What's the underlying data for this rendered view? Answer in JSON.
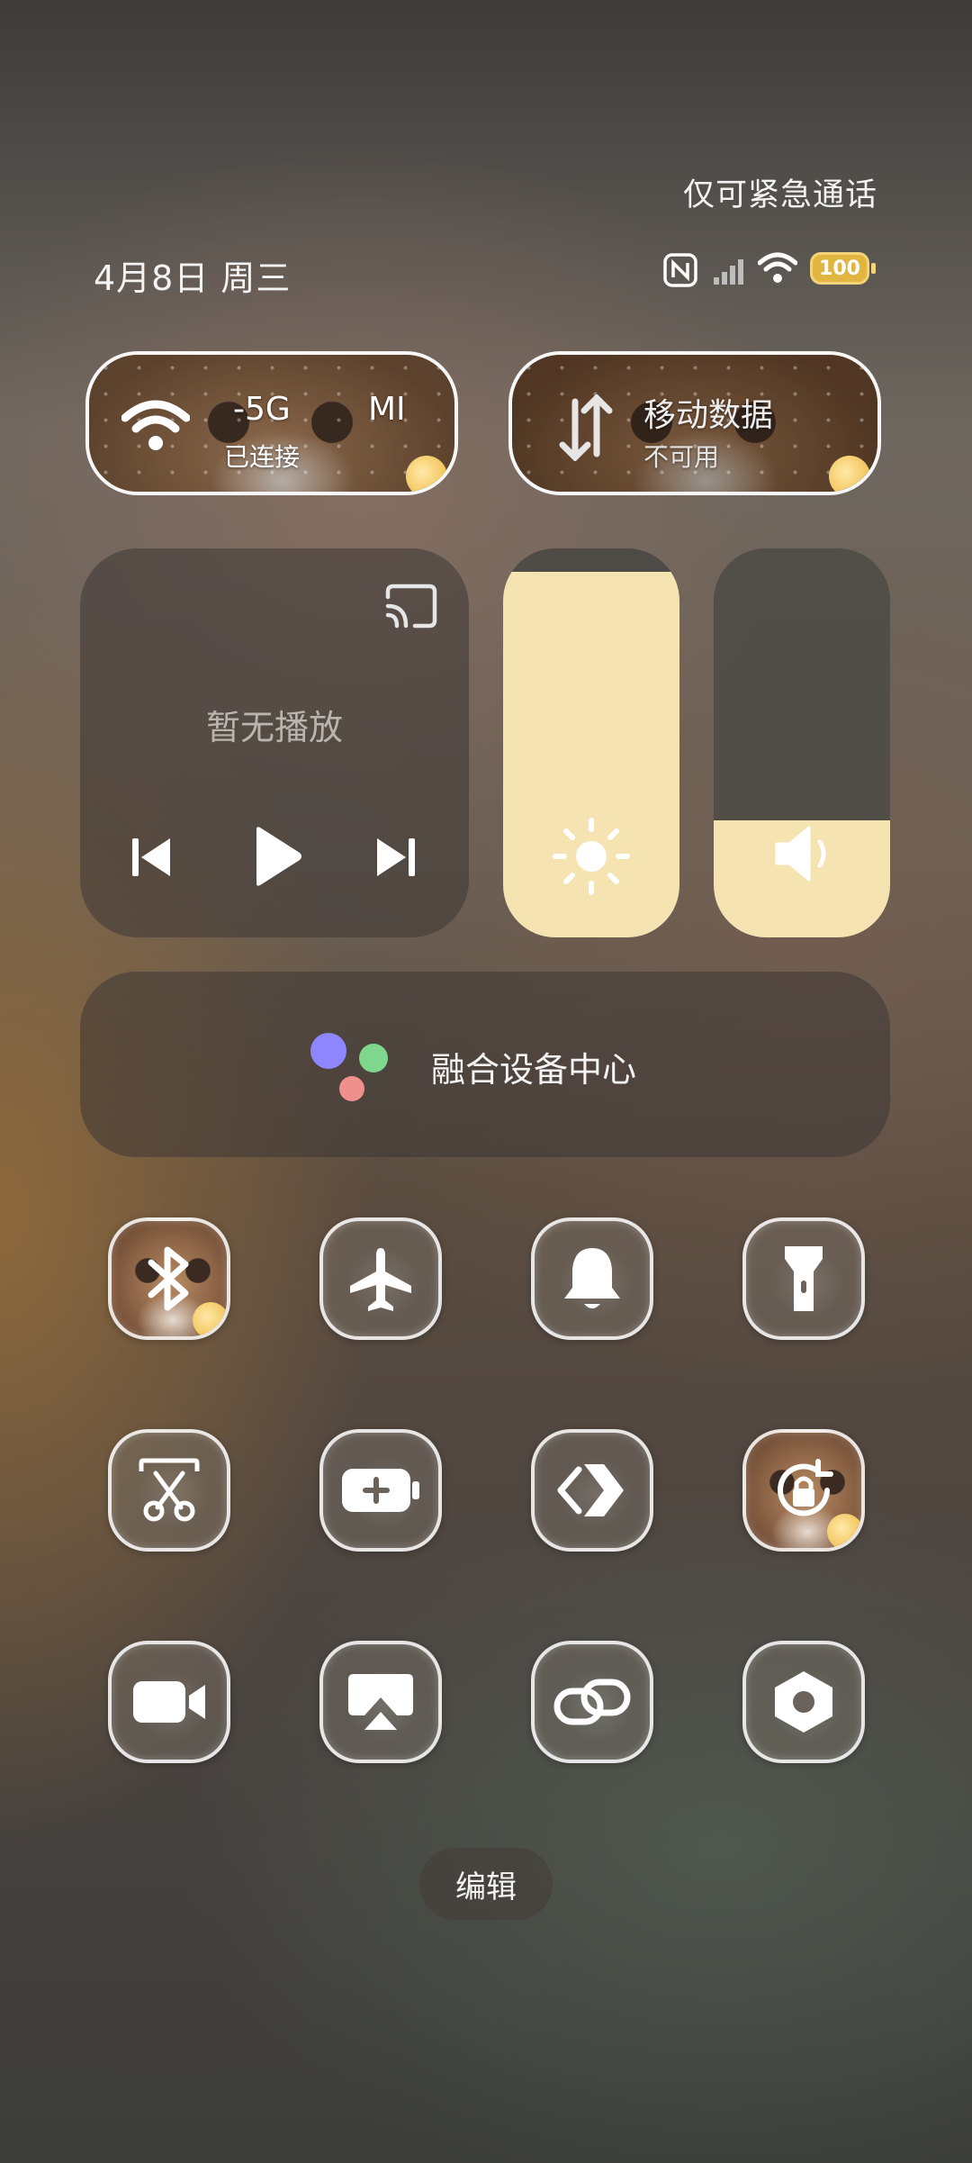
{
  "status_bar": {
    "emergency_text": "仅可紧急通话",
    "date": "4月8日 周三",
    "battery": "100"
  },
  "wifi_tile": {
    "ssid_fragment_1": "-5G",
    "ssid_fragment_2": "MI",
    "status": "已连接"
  },
  "data_tile": {
    "title": "移动数据",
    "status": "不可用"
  },
  "media": {
    "empty_text": "暂无播放"
  },
  "brightness": {
    "level_percent": 100
  },
  "volume": {
    "level_percent": 30
  },
  "device_center": {
    "label": "融合设备中心"
  },
  "toggles": [
    {
      "name": "bluetooth",
      "icon": "bluetooth-icon"
    },
    {
      "name": "airplane-mode",
      "icon": "airplane-icon"
    },
    {
      "name": "ring-mode",
      "icon": "bell-icon"
    },
    {
      "name": "flashlight",
      "icon": "flashlight-icon"
    },
    {
      "name": "screenshot",
      "icon": "scissors-icon"
    },
    {
      "name": "battery-saver",
      "icon": "battery-plus-icon"
    },
    {
      "name": "share",
      "icon": "share-arrow-icon"
    },
    {
      "name": "rotation-lock",
      "icon": "rotation-lock-icon"
    },
    {
      "name": "screen-record",
      "icon": "video-camera-icon"
    },
    {
      "name": "cast",
      "icon": "screen-cast-icon"
    },
    {
      "name": "link",
      "icon": "link-icon"
    },
    {
      "name": "settings",
      "icon": "hex-nut-icon"
    }
  ],
  "edit_button": {
    "label": "编辑"
  },
  "colors": {
    "accent_fill": "#f5e3b1",
    "wifi_sub_accent": "#ffffff"
  }
}
